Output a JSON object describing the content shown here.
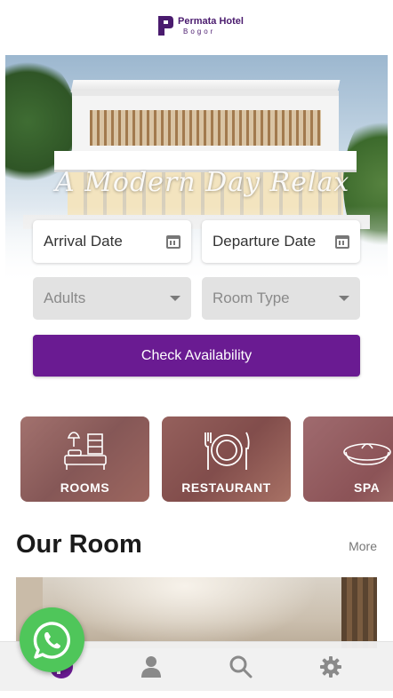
{
  "brand": {
    "name": "Permata Hotel",
    "city": "Bogor",
    "accent_color": "#6a1b92"
  },
  "hero": {
    "tagline": "A Modern Day Relax"
  },
  "booking_form": {
    "arrival_placeholder": "Arrival Date",
    "departure_placeholder": "Departure Date",
    "adults_placeholder": "Adults",
    "room_type_placeholder": "Room Type",
    "check_button_label": "Check Availability"
  },
  "categories": [
    {
      "label": "ROOMS",
      "icon": "bedroom-icon"
    },
    {
      "label": "RESTAURANT",
      "icon": "plate-cutlery-icon"
    },
    {
      "label": "SPA",
      "icon": "spa-bowl-icon"
    }
  ],
  "our_room": {
    "title": "Our Room",
    "more_label": "More"
  },
  "bottom_nav": {
    "items": [
      {
        "icon": "home-logo-icon"
      },
      {
        "icon": "user-icon"
      },
      {
        "icon": "search-icon"
      },
      {
        "icon": "gear-icon"
      }
    ]
  },
  "floating": {
    "icon": "whatsapp-icon",
    "color": "#4fc65a"
  }
}
